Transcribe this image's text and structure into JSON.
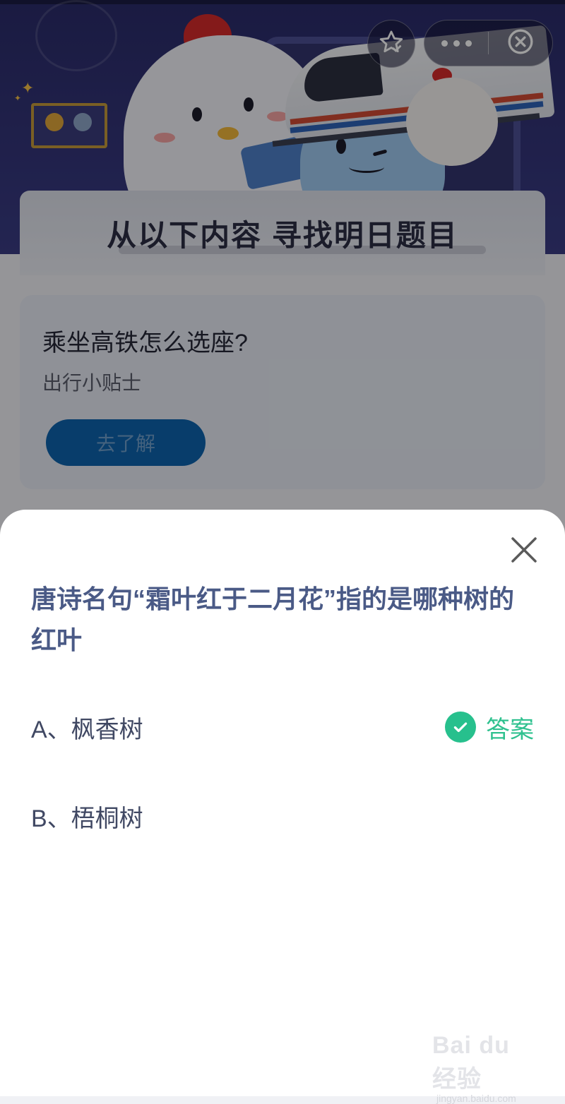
{
  "hero": {
    "title": "从以下内容  寻找明日题目"
  },
  "promo": {
    "title": "乘坐高铁怎么选座?",
    "subtitle": "出行小贴士",
    "button_label": "去了解"
  },
  "capsule": {
    "favorite_icon": "star-check-icon",
    "more_icon": "more-dots-icon",
    "exit_icon": "close-circle-icon"
  },
  "sheet": {
    "close_icon": "close-icon",
    "question": "唐诗名句“霜叶红于二月花”指的是哪种树的红叶",
    "options": [
      {
        "label": "A、枫香树",
        "is_answer": true
      },
      {
        "label": "B、梧桐树",
        "is_answer": false
      }
    ],
    "answer_label": "答案"
  },
  "watermark": {
    "main": "Bai du 经验",
    "sub": "jingyan.baidu.com"
  },
  "colors": {
    "hero_bg": "#2b2c6a",
    "question_text": "#4a5a86",
    "answer_green": "#27c08d",
    "promo_button": "#0e63ad"
  }
}
